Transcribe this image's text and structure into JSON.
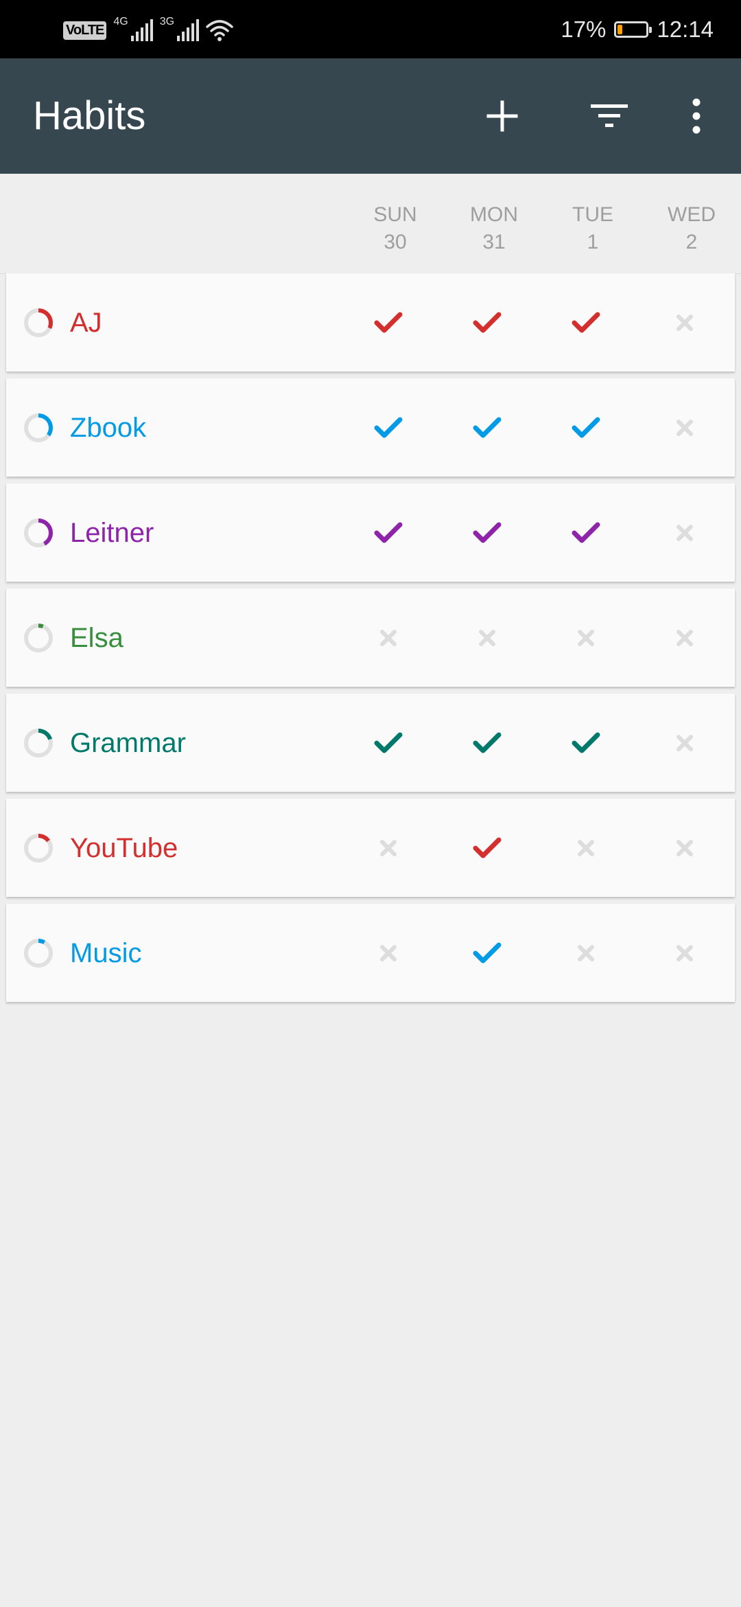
{
  "status_bar": {
    "left_indicators": [
      "VoLTE",
      "4G",
      "3G",
      "wifi-icon"
    ],
    "battery_percent": "17%",
    "battery_level": 0.17,
    "time": "12:14"
  },
  "app_bar": {
    "title": "Habits",
    "actions": [
      "add-icon",
      "filter-icon",
      "more-vert-icon"
    ]
  },
  "days": [
    {
      "weekday": "SUN",
      "date": "30"
    },
    {
      "weekday": "MON",
      "date": "31"
    },
    {
      "weekday": "TUE",
      "date": "1"
    },
    {
      "weekday": "WED",
      "date": "2"
    }
  ],
  "habits": [
    {
      "name": "AJ",
      "color": "#d32f2f",
      "score": 0.32,
      "checks": [
        true,
        true,
        true,
        false
      ]
    },
    {
      "name": "Zbook",
      "color": "#039be5",
      "score": 0.35,
      "checks": [
        true,
        true,
        true,
        false
      ]
    },
    {
      "name": "Leitner",
      "color": "#8e24aa",
      "score": 0.42,
      "checks": [
        true,
        true,
        true,
        false
      ]
    },
    {
      "name": "Elsa",
      "color": "#388e3c",
      "score": 0.06,
      "checks": [
        false,
        false,
        false,
        false
      ]
    },
    {
      "name": "Grammar",
      "color": "#00796b",
      "score": 0.2,
      "checks": [
        true,
        true,
        true,
        false
      ]
    },
    {
      "name": "YouTube",
      "color": "#d32f2f",
      "score": 0.15,
      "checks": [
        false,
        true,
        false,
        false
      ]
    },
    {
      "name": "Music",
      "color": "#039be5",
      "score": 0.08,
      "checks": [
        false,
        true,
        false,
        false
      ]
    }
  ],
  "colors": {
    "app_bar": "#37474f",
    "unchecked": "#dddddd",
    "background": "#eeeeee"
  }
}
